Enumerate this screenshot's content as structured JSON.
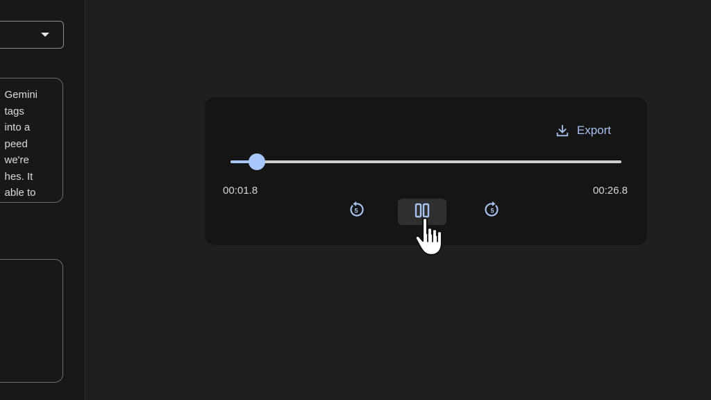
{
  "left_panel": {
    "text_box": {
      "lines": [
        "Gemini",
        "tags",
        "into a",
        "peed",
        "we're",
        "hes. It",
        "able to"
      ]
    }
  },
  "player": {
    "export_label": "Export",
    "current_time": "00:01.8",
    "total_time": "00:26.8",
    "progress": 0.068,
    "skip_seconds": "5",
    "accent_color": "#a8c7fa"
  },
  "icons": {
    "export": "download-icon",
    "rewind": "replay-5-icon",
    "pause": "pause-icon",
    "forward": "forward-5-icon",
    "cursor": "hand-pointer-icon"
  }
}
